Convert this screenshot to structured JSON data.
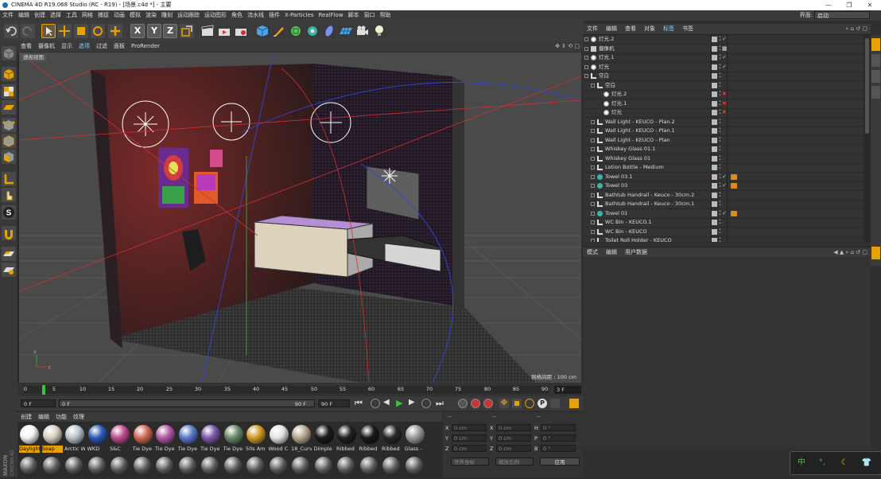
{
  "window": {
    "title": "CINEMA 4D R19.068 Studio (RC - R19) - [场景.c4d *] - 主要",
    "controls": [
      "—",
      "❐",
      "✕"
    ]
  },
  "menubar": {
    "items": [
      "文件",
      "编辑",
      "创建",
      "选择",
      "工具",
      "网格",
      "捕捉",
      "动画",
      "模拟",
      "渲染",
      "雕刻",
      "运动跟踪",
      "运动图形",
      "角色",
      "流水线",
      "插件",
      "X-Particles",
      "RealFlow",
      "脚本",
      "窗口",
      "帮助"
    ],
    "layout_label": "界面:",
    "layout_value": "启动"
  },
  "toolbar": {
    "axis_x": "X",
    "axis_y": "Y",
    "axis_z": "Z"
  },
  "viewport": {
    "menu": [
      "查看",
      "摄像机",
      "显示",
      "选项",
      "过滤",
      "面板",
      "ProRender"
    ],
    "menu_highlight": "选项",
    "label": "透视视图",
    "grid_spacing": "网格间距 : 100 cm",
    "axis_y": "Y",
    "axis_x": "X"
  },
  "timeline": {
    "ticks": [
      "0",
      "5",
      "10",
      "15",
      "20",
      "25",
      "30",
      "35",
      "40",
      "45",
      "50",
      "55",
      "60",
      "65",
      "70",
      "75",
      "80",
      "85",
      "90"
    ],
    "current_frame": "3 F",
    "start_field": "0 F",
    "preview_start": "0 F",
    "preview_end": "90 F",
    "end_field": "90 F"
  },
  "material_manager": {
    "menu": [
      "创建",
      "编辑",
      "功能",
      "纹理"
    ],
    "materials": [
      {
        "name": "Daylight",
        "color": "#f4f4f4",
        "selected": true
      },
      {
        "name": "Soap",
        "color": "#d8d0c0",
        "selected": true
      },
      {
        "name": "Arctic W",
        "color": "#b8c4cc",
        "selected": false
      },
      {
        "name": "WKD",
        "color": "#2e5cb8",
        "selected": false
      },
      {
        "name": "S&C",
        "color": "#c04e8e",
        "selected": false
      },
      {
        "name": "Tie Dye",
        "color": "#d06a58",
        "selected": false
      },
      {
        "name": "Tie Dye",
        "color": "#b05aa6",
        "selected": false
      },
      {
        "name": "Tie Dye",
        "color": "#5a7acb",
        "selected": false
      },
      {
        "name": "Tie Dye",
        "color": "#7a5aaa",
        "selected": false
      },
      {
        "name": "Tie Dye",
        "color": "#6a8a6a",
        "selected": false
      },
      {
        "name": "50s Am",
        "color": "#d39a2a",
        "selected": false
      },
      {
        "name": "Wood C",
        "color": "#e4e4e4",
        "selected": false
      },
      {
        "name": "18_Curv",
        "color": "#b6a890",
        "selected": false
      },
      {
        "name": "Dimple",
        "color": "#1c1c1c",
        "selected": false
      },
      {
        "name": "Ribbed",
        "color": "#222222",
        "selected": false
      },
      {
        "name": "Ribbed",
        "color": "#1a1a1a",
        "selected": false
      },
      {
        "name": "Ribbed",
        "color": "#2a2a2a",
        "selected": false
      },
      {
        "name": "Glass -",
        "color": "#9a9a9a",
        "selected": false
      }
    ]
  },
  "coordinates": {
    "header_a": "--",
    "header_b": "--",
    "header_c": "--",
    "rows": [
      {
        "a_label": "X",
        "a_value": "0 cm",
        "b_label": "X",
        "b_value": "0 cm",
        "c_label": "H",
        "c_value": "0 °"
      },
      {
        "a_label": "Y",
        "a_value": "0 cm",
        "b_label": "Y",
        "b_value": "0 cm",
        "c_label": "P",
        "c_value": "0 °"
      },
      {
        "a_label": "Z",
        "a_value": "0 cm",
        "b_label": "Z",
        "b_value": "0 cm",
        "c_label": "B",
        "c_value": "0 °"
      }
    ],
    "mode_world": "世界坐标",
    "mode_scale": "缩放比例",
    "apply": "应用"
  },
  "object_manager": {
    "tabs": [
      "文件",
      "编辑",
      "查看",
      "对象",
      "标签",
      "书签"
    ],
    "tab_highlight": "标签",
    "objects": [
      {
        "name": "灯光.2",
        "indent": 0,
        "icon": "light",
        "check": "green",
        "tag": false
      },
      {
        "name": "摄像机",
        "indent": 0,
        "icon": "camera",
        "check": "grid",
        "tag": false
      },
      {
        "name": "灯光.1",
        "indent": 0,
        "icon": "light",
        "check": "green",
        "tag": false
      },
      {
        "name": "灯光",
        "indent": 0,
        "icon": "light",
        "check": "green",
        "tag": false
      },
      {
        "name": "空白",
        "indent": 0,
        "icon": "null",
        "check": "none",
        "tag": false
      },
      {
        "name": "空白",
        "indent": 1,
        "icon": "null",
        "check": "none",
        "tag": false
      },
      {
        "name": "灯光.2",
        "indent": 2,
        "icon": "light",
        "check": "red",
        "tag": false
      },
      {
        "name": "灯光.1",
        "indent": 2,
        "icon": "light",
        "check": "red",
        "tag": false
      },
      {
        "name": "灯光",
        "indent": 2,
        "icon": "light",
        "check": "red",
        "tag": false
      },
      {
        "name": "Wall Light - KEUCO - Plan.2",
        "indent": 1,
        "icon": "null",
        "check": "none",
        "tag": false
      },
      {
        "name": "Wall Light - KEUCO - Plan.1",
        "indent": 1,
        "icon": "null",
        "check": "none",
        "tag": false
      },
      {
        "name": "Wall Light - KEUCO - Plan",
        "indent": 1,
        "icon": "null",
        "check": "none",
        "tag": false
      },
      {
        "name": "Whiskey Glass 01.1",
        "indent": 1,
        "icon": "null",
        "check": "none",
        "tag": false
      },
      {
        "name": "Whiskey Glass 01",
        "indent": 1,
        "icon": "null",
        "check": "none",
        "tag": false
      },
      {
        "name": "Lotion Bottle - Medium",
        "indent": 1,
        "icon": "null",
        "check": "none",
        "tag": false
      },
      {
        "name": "Towel 03.1",
        "indent": 1,
        "icon": "towel",
        "check": "green",
        "tag": true
      },
      {
        "name": "Towel 03",
        "indent": 1,
        "icon": "towel",
        "check": "green",
        "tag": true
      },
      {
        "name": "Bathtub Handrail - Keuco - 30cm.2",
        "indent": 1,
        "icon": "null",
        "check": "none",
        "tag": false
      },
      {
        "name": "Bathtub Handrail - Keuco - 30cm.1",
        "indent": 1,
        "icon": "null",
        "check": "none",
        "tag": false
      },
      {
        "name": "Towel 01",
        "indent": 1,
        "icon": "towel",
        "check": "green",
        "tag": true
      },
      {
        "name": "WC Bin - KEUCO.1",
        "indent": 1,
        "icon": "null",
        "check": "none",
        "tag": false
      },
      {
        "name": "WC Bin - KEUCO",
        "indent": 1,
        "icon": "null",
        "check": "none",
        "tag": false
      },
      {
        "name": "Toilet Roll Holder - KEUCO",
        "indent": 1,
        "icon": "null",
        "check": "none",
        "tag": false
      }
    ]
  },
  "attribute_manager": {
    "tabs": [
      "模式",
      "编辑",
      "用户数据"
    ]
  },
  "ime": {
    "items": [
      "中",
      "°,",
      "☾",
      "👕"
    ]
  }
}
